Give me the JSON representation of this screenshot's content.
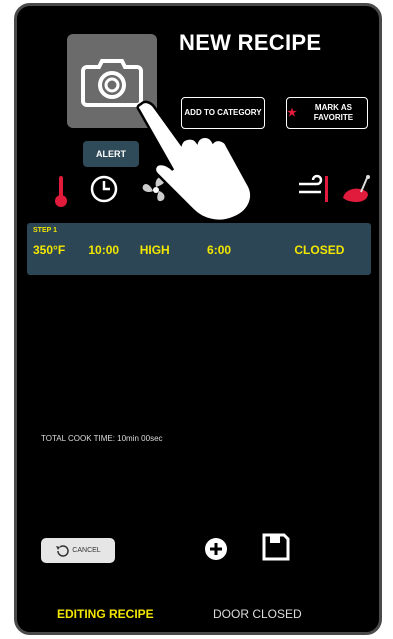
{
  "header": {
    "title": "NEW RECIPE",
    "add_to_category": "ADD TO CATEGORY",
    "mark_as_favorite": "MARK AS FAVORITE",
    "alert": "ALERT"
  },
  "icons": [
    "camera-icon",
    "thermometer-icon",
    "clock-icon",
    "fan-icon",
    "wind-icon",
    "meat-probe-icon",
    "hand-pointer-icon"
  ],
  "step": {
    "label": "STEP 1",
    "temperature": "350°F",
    "time": "10:00",
    "fan": "HIGH",
    "duration": "6:00",
    "damper": "CLOSED"
  },
  "total_cook_time": "TOTAL COOK TIME: 10min 00sec",
  "controls": {
    "cancel": "CANCEL"
  },
  "status": {
    "mode": "EDITING RECIPE",
    "door": "DOOR CLOSED"
  },
  "colors": {
    "accent_yellow": "#f2e600",
    "step_bar": "#2c4656",
    "favorite_star": "#e01b3c",
    "thermometer_red": "#e01b3c"
  }
}
